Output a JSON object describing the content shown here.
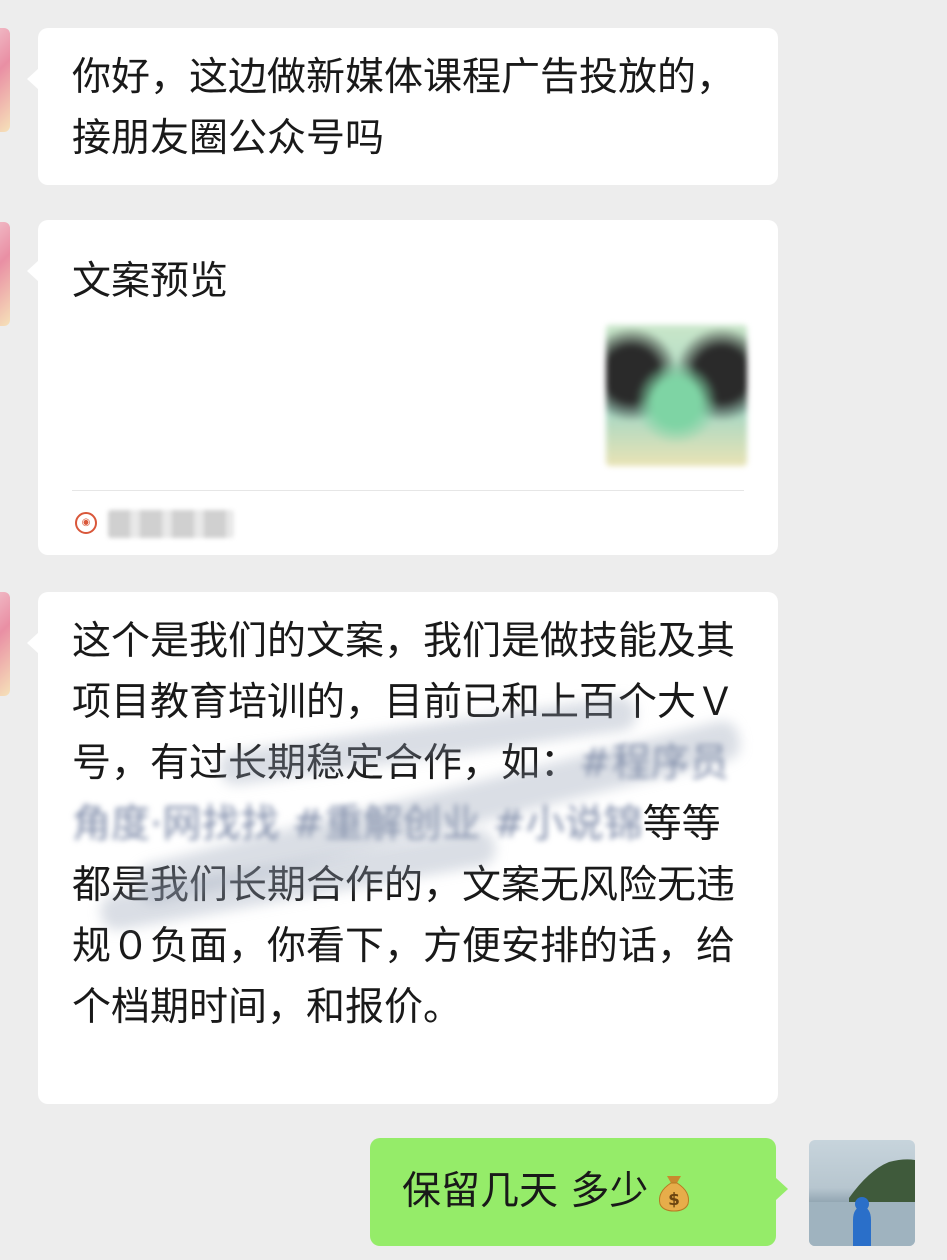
{
  "messages": [
    {
      "side": "left",
      "type": "text",
      "text": "你好，这边做新媒体课程广告投放的，接朋友圈公众号吗"
    },
    {
      "side": "left",
      "type": "article_card",
      "title": "文案预览"
    },
    {
      "side": "left",
      "type": "text",
      "segments": {
        "a": "这个是我们的文案，我们是做技能及其项目教育培训的，目前已和上百个大Ｖ号，有过长期稳定合作，如：",
        "hashtag1": "#程序员角度·网找找",
        "space": " ",
        "hashtag2": "#重解创业 #小说锦",
        "b": "等等 都是我们长期合作的，文案无风险无违规０负面，你看下，方便安排的话，给个档期时间，和报价。"
      }
    },
    {
      "side": "right",
      "type": "text",
      "text": "保留几天 多少",
      "emoji": "money-bag"
    }
  ],
  "colors": {
    "background": "#ededed",
    "bubble_left": "#ffffff",
    "bubble_right": "#95ec69",
    "hashtag": "#576b95"
  }
}
